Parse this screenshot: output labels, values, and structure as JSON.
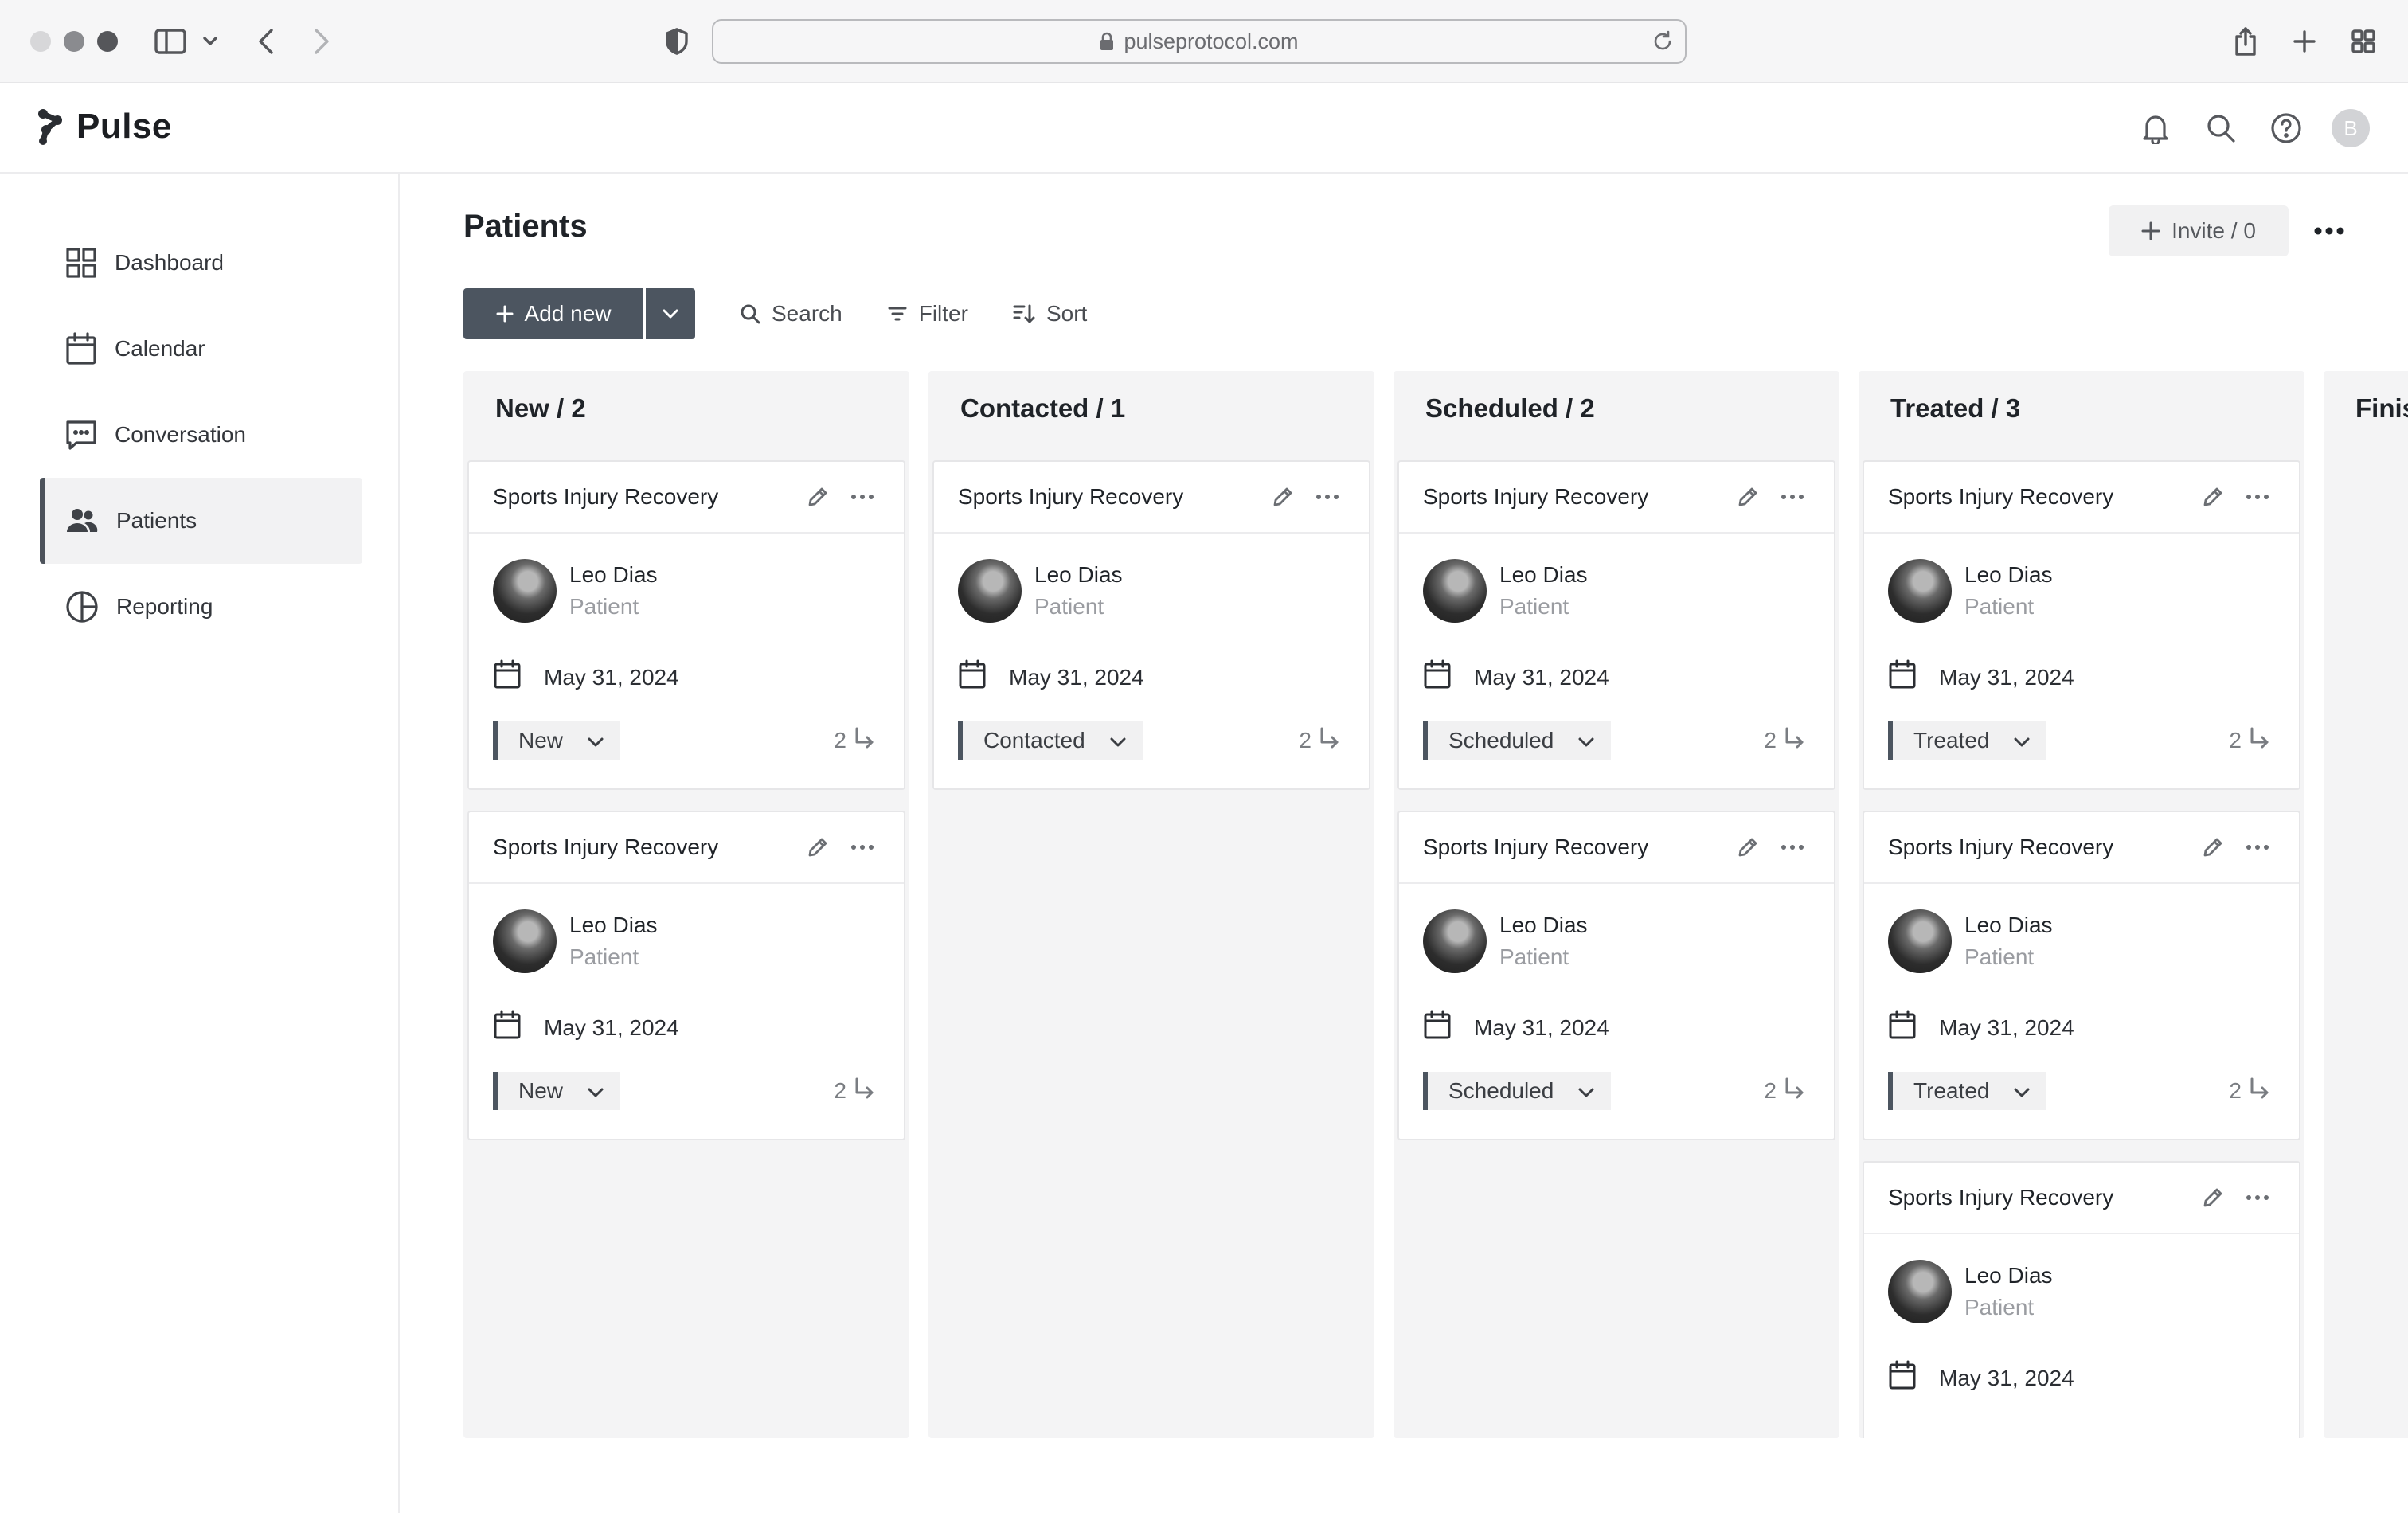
{
  "browser": {
    "url": "pulseprotocol.com"
  },
  "app": {
    "brand": "Pulse",
    "avatar_initial": "B"
  },
  "sidebar": {
    "items": [
      {
        "label": "Dashboard",
        "icon": "grid-icon"
      },
      {
        "label": "Calendar",
        "icon": "calendar-icon"
      },
      {
        "label": "Conversation",
        "icon": "chat-icon"
      },
      {
        "label": "Patients",
        "icon": "users-icon",
        "active": true
      },
      {
        "label": "Reporting",
        "icon": "pie-chart-icon"
      }
    ]
  },
  "main": {
    "title": "Patients",
    "invite_label": "Invite / 0",
    "toolbar": {
      "add_new": "Add new",
      "search": "Search",
      "filter": "Filter",
      "sort": "Sort"
    },
    "columns": [
      {
        "title": "New / 2",
        "cards": [
          {
            "title": "Sports Injury Recovery",
            "name": "Leo Dias",
            "role": "Patient",
            "date": "May 31, 2024",
            "status": "New",
            "subtasks": "2"
          },
          {
            "title": "Sports Injury Recovery",
            "name": "Leo Dias",
            "role": "Patient",
            "date": "May 31, 2024",
            "status": "New",
            "subtasks": "2"
          }
        ]
      },
      {
        "title": "Contacted / 1",
        "cards": [
          {
            "title": "Sports Injury Recovery",
            "name": "Leo Dias",
            "role": "Patient",
            "date": "May 31, 2024",
            "status": "Contacted",
            "subtasks": "2"
          }
        ]
      },
      {
        "title": "Scheduled / 2",
        "cards": [
          {
            "title": "Sports Injury Recovery",
            "name": "Leo Dias",
            "role": "Patient",
            "date": "May 31, 2024",
            "status": "Scheduled",
            "subtasks": "2"
          },
          {
            "title": "Sports Injury Recovery",
            "name": "Leo Dias",
            "role": "Patient",
            "date": "May 31, 2024",
            "status": "Scheduled",
            "subtasks": "2"
          }
        ]
      },
      {
        "title": "Treated / 3",
        "cards": [
          {
            "title": "Sports Injury Recovery",
            "name": "Leo Dias",
            "role": "Patient",
            "date": "May 31, 2024",
            "status": "Treated",
            "subtasks": "2"
          },
          {
            "title": "Sports Injury Recovery",
            "name": "Leo Dias",
            "role": "Patient",
            "date": "May 31, 2024",
            "status": "Treated",
            "subtasks": "2"
          },
          {
            "title": "Sports Injury Recovery",
            "name": "Leo Dias",
            "role": "Patient",
            "date": "May 31, 2024",
            "status": "",
            "subtasks": ""
          }
        ]
      }
    ],
    "partial_column_title": "Finis"
  },
  "colors": {
    "accent": "#4c5560",
    "column_bg": "#f4f4f5",
    "active_nav_bg": "#f2f2f3"
  }
}
